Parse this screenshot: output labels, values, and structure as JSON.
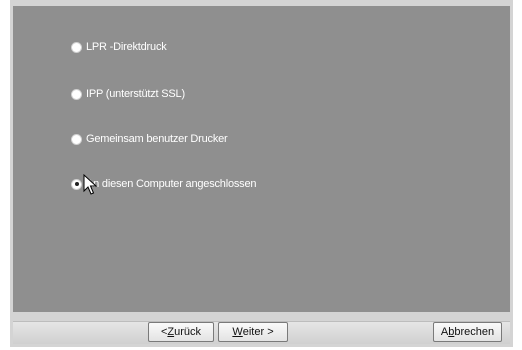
{
  "options": [
    {
      "label": "LPR -Direktdruck",
      "selected": false
    },
    {
      "label": "IPP (unterstützt SSL)",
      "selected": false
    },
    {
      "label": "Gemeinsam benutzer Drucker",
      "selected": false
    },
    {
      "label": "An diesen Computer angeschlossen",
      "selected": true
    }
  ],
  "buttons": {
    "back": {
      "prefix": "< ",
      "accel": "Z",
      "rest": "urück"
    },
    "next": {
      "accel": "W",
      "rest": "eiter >"
    },
    "cancel": {
      "prefix": "A",
      "accel": "b",
      "rest": "brechen"
    }
  },
  "colors": {
    "panel": "#8f8f8f",
    "window": "#d4d4d4",
    "text": "#ffffff"
  },
  "icons": {
    "cursor": "arrow-cursor-icon"
  }
}
